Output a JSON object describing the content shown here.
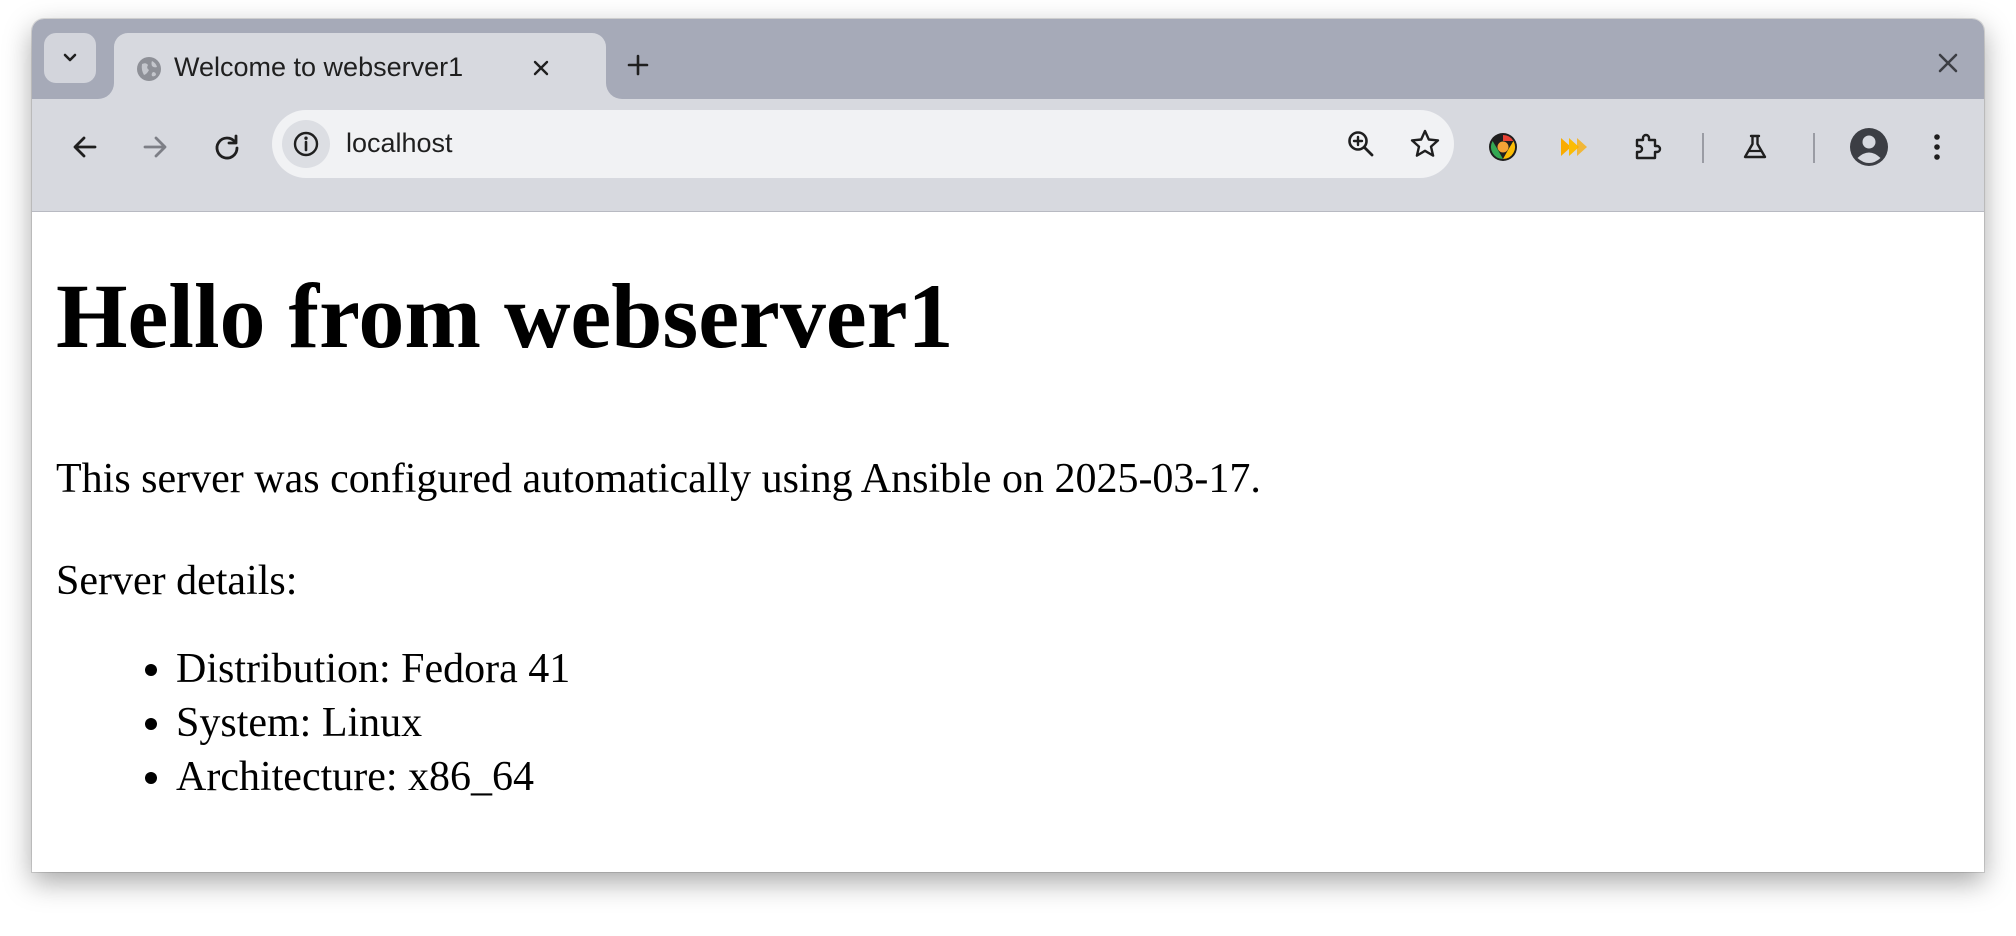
{
  "browser": {
    "tab": {
      "title": "Welcome to webserver1",
      "favicon": "globe-icon"
    },
    "omnibox": {
      "url": "localhost"
    },
    "toolbar_icons": [
      "back-arrow-icon",
      "forward-arrow-icon",
      "reload-icon",
      "site-info-icon",
      "zoom-icon",
      "star-icon",
      "extension-chrome-icon",
      "extension-forward-icon",
      "extensions-puzzle-icon",
      "labs-flask-icon",
      "profile-avatar-icon",
      "kebab-menu-icon"
    ]
  },
  "page": {
    "heading": "Hello from webserver1",
    "intro": "This server was configured automatically using Ansible on 2025-03-17.",
    "details_label": "Server details:",
    "details": [
      "Distribution: Fedora 41",
      "System: Linux",
      "Architecture: x86_64"
    ]
  },
  "colors": {
    "tabstrip": "#a6aab8",
    "toolbar": "#d7d9df",
    "omnibox": "#f1f2f4",
    "page_background": "#ffffff",
    "text": "#000000"
  }
}
